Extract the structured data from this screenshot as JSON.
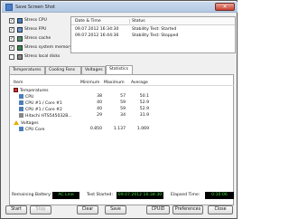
{
  "window": {
    "title": "Save Screen Shot",
    "close_glyph": "×"
  },
  "stress": {
    "items": [
      {
        "label": "Stress CPU",
        "checked": true,
        "icon": "cpu-icon"
      },
      {
        "label": "Stress FPU",
        "checked": true,
        "icon": "fpu-icon"
      },
      {
        "label": "Stress cache",
        "checked": true,
        "icon": "cache-icon"
      },
      {
        "label": "Stress system memory",
        "checked": true,
        "icon": "memory-icon"
      },
      {
        "label": "Stress local disks",
        "checked": false,
        "icon": "disk-icon"
      }
    ]
  },
  "log": {
    "headers": {
      "datetime": "Date & Time",
      "status": "Status"
    },
    "rows": [
      {
        "datetime": "09.07.2012 16:34:30",
        "status": "Stability Test: Started"
      },
      {
        "datetime": "09.07.2012 16:44:36",
        "status": "Stability Test: Stopped"
      }
    ]
  },
  "tabs": [
    "Temperatures",
    "Cooling Fans",
    "Voltages",
    "Statistics"
  ],
  "stats": {
    "headers": {
      "item": "Item",
      "min": "Minimum",
      "max": "Maximum",
      "avg": "Average"
    },
    "groups": [
      {
        "label": "Temperatures",
        "rows": [
          {
            "name": "CPU",
            "min": "38",
            "max": "57",
            "avg": "50.1"
          },
          {
            "name": "CPU #1 / Core #1",
            "min": "40",
            "max": "59",
            "avg": "52.9"
          },
          {
            "name": "CPU #1 / Core #2",
            "min": "40",
            "max": "59",
            "avg": "52.9"
          },
          {
            "name": "Hitachi HTS545032B...",
            "min": "29",
            "max": "34",
            "avg": "31.9"
          }
        ]
      },
      {
        "label": "Voltages",
        "rows": [
          {
            "name": "CPU Core",
            "min": "0.850",
            "max": "1.137",
            "avg": "1.069"
          }
        ]
      }
    ]
  },
  "status": {
    "battery_label": "Remaining Battery:",
    "battery_value": "AC Line",
    "started_label": "Test Started:",
    "started_value": "09.07.2012 16:34:30",
    "elapsed_label": "Elapsed Time:",
    "elapsed_value": "0:10:06"
  },
  "buttons": {
    "start": "Start",
    "stop": "Stop",
    "clear": "Clear",
    "save": "Save",
    "cpuid": "CPUID",
    "preferences": "Preferences",
    "close": "Close"
  },
  "colors": {
    "value_bg": "#000000",
    "value_fg": "#3fe33f",
    "titlebar": "#b4c9e3"
  }
}
